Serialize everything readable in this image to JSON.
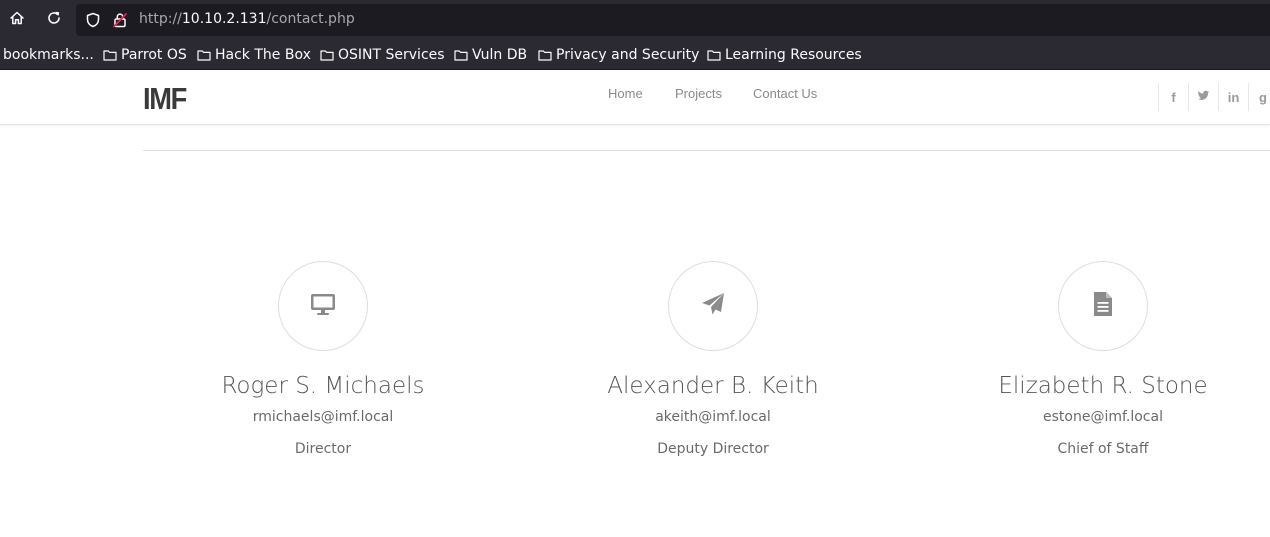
{
  "browser": {
    "url_scheme": "http://",
    "url_host": "10.10.2.131",
    "url_path": "/contact.php",
    "icons": {
      "home": "home-icon",
      "reload": "reload-icon",
      "shield": "shield-icon",
      "insecure_lock": "insecure-lock-icon"
    },
    "bookmarks": [
      {
        "label": "bookmarks...",
        "folder": false
      },
      {
        "label": "Parrot OS",
        "folder": true
      },
      {
        "label": "Hack The Box",
        "folder": true
      },
      {
        "label": "OSINT Services",
        "folder": true
      },
      {
        "label": "Vuln DB",
        "folder": true
      },
      {
        "label": "Privacy and Security",
        "folder": true
      },
      {
        "label": "Learning Resources",
        "folder": true
      }
    ]
  },
  "site": {
    "logo": "IMF",
    "nav": [
      {
        "label": "Home"
      },
      {
        "label": "Projects"
      },
      {
        "label": "Contact Us"
      }
    ],
    "social": [
      {
        "name": "facebook-icon",
        "glyph": "f"
      },
      {
        "name": "twitter-icon",
        "glyph": ""
      },
      {
        "name": "linkedin-icon",
        "glyph": "in"
      },
      {
        "name": "google-plus-icon",
        "glyph": "g"
      }
    ]
  },
  "contacts": [
    {
      "icon": "desktop-icon",
      "name": "Roger S. Michaels",
      "email": "rmichaels@imf.local",
      "role": "Director"
    },
    {
      "icon": "paper-plane-icon",
      "name": "Alexander B. Keith",
      "email": "akeith@imf.local",
      "role": "Deputy Director"
    },
    {
      "icon": "document-icon",
      "name": "Elizabeth R. Stone",
      "email": "estone@imf.local",
      "role": "Chief of Staff"
    }
  ],
  "colors": {
    "chrome_bg": "#2b2a33",
    "urlbox_bg": "#1c1b22",
    "icon_gray": "#8a8a8a",
    "insecure_red": "#e22850"
  }
}
